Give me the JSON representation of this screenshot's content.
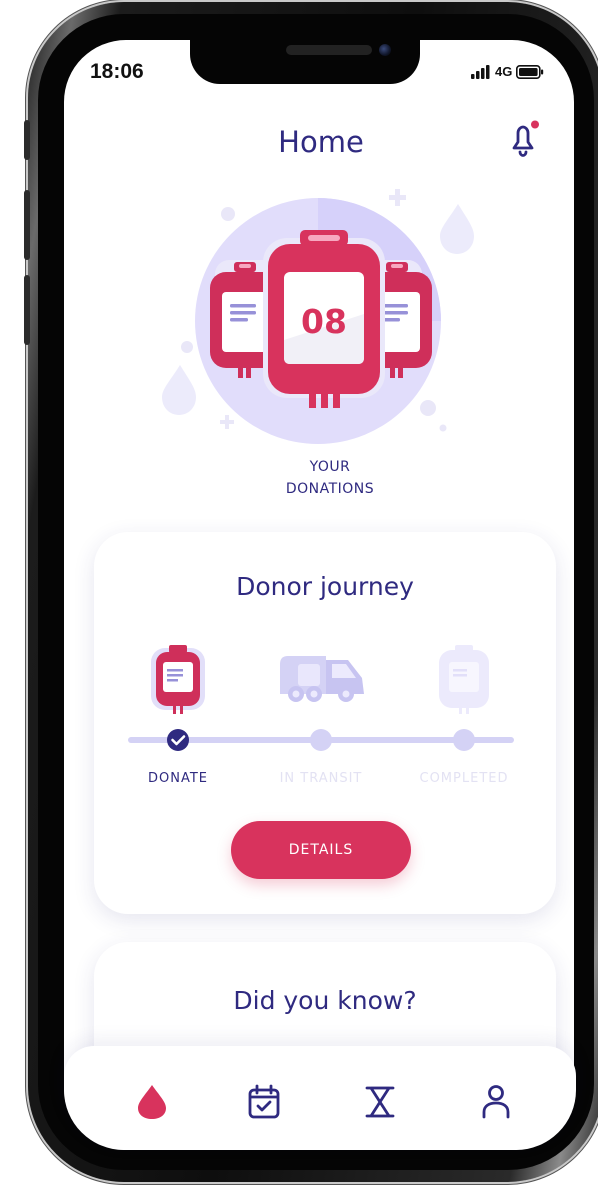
{
  "status_bar": {
    "time": "18:06",
    "network": "4G"
  },
  "header": {
    "title": "Home"
  },
  "donations": {
    "count": "08",
    "label_line1": "YOUR",
    "label_line2": "DONATIONS"
  },
  "journey": {
    "title": "Donor journey",
    "stages": [
      {
        "label": "DONATE",
        "state": "done"
      },
      {
        "label": "IN TRANSIT",
        "state": "pending"
      },
      {
        "label": "COMPLETED",
        "state": "pending"
      }
    ],
    "details_label": "DETAILS"
  },
  "did_you_know": {
    "title": "Did you know?"
  },
  "tabbar": {
    "tabs": [
      {
        "icon": "drop-icon",
        "active": true
      },
      {
        "icon": "calendar-check-icon",
        "active": false
      },
      {
        "icon": "hourglass-icon",
        "active": false
      },
      {
        "icon": "user-icon",
        "active": false
      }
    ]
  },
  "colors": {
    "primary": "#d8335d",
    "text_dark": "#2f2a80",
    "inactive_text": "#e3e2f3",
    "track": "#d4d2f5",
    "notification_dot": "#d8335d"
  }
}
